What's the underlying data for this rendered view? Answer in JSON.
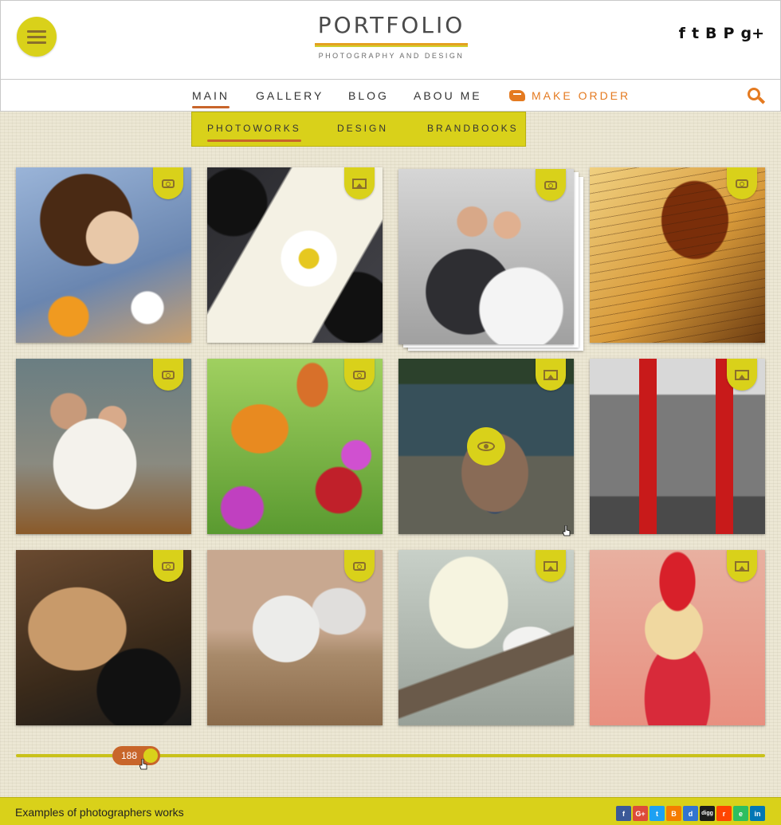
{
  "header": {
    "logo_title": "PORTFOLIO",
    "logo_subtitle": "PHOTOGRAPHY AND DESIGN",
    "social": [
      {
        "name": "facebook",
        "glyph": "f"
      },
      {
        "name": "twitter",
        "glyph": "t"
      },
      {
        "name": "blogger",
        "glyph": "B"
      },
      {
        "name": "pinterest",
        "glyph": "P"
      },
      {
        "name": "google-plus",
        "glyph": "g+"
      }
    ]
  },
  "nav": {
    "items": [
      "MAIN",
      "GALLERY",
      "BLOG",
      "ABOU ME"
    ],
    "order_label": "MAKE ORDER",
    "active": "MAIN"
  },
  "subnav": {
    "items": [
      "PHOTOWORKS",
      "DESIGN",
      "BRANDBOOKS"
    ],
    "active": "PHOTOWORKS"
  },
  "gallery": {
    "tiles": [
      {
        "subject": "woman-with-flowers",
        "badge": "camera-icon",
        "colors": [
          "#8aa3c8",
          "#e89a2a",
          "#5a3a20"
        ]
      },
      {
        "subject": "cameras-and-daisy-photo",
        "badge": "picture-icon",
        "colors": [
          "#2a2a2e",
          "#f4f1e4",
          "#e6c820"
        ]
      },
      {
        "subject": "wedding-couple-kiss",
        "badge": "camera-icon",
        "colors": [
          "#b8b8b8",
          "#3a3a3a",
          "#f2f2f2"
        ]
      },
      {
        "subject": "violin-on-sheet-music",
        "badge": "camera-icon",
        "colors": [
          "#6a3a10",
          "#d89a3a",
          "#f0d080"
        ]
      },
      {
        "subject": "couple-on-beach",
        "badge": "camera-icon",
        "colors": [
          "#7a8a8a",
          "#f2f0ea",
          "#8a5a2a"
        ]
      },
      {
        "subject": "butterflies-on-flowers",
        "badge": "camera-icon",
        "colors": [
          "#7ab840",
          "#e08a20",
          "#c040c0"
        ]
      },
      {
        "subject": "woman-on-beach",
        "badge": "picture-icon",
        "colors": [
          "#5a7a8a",
          "#c89a7a",
          "#2a4a6a"
        ]
      },
      {
        "subject": "red-telephone-booths",
        "badge": "picture-icon",
        "colors": [
          "#8a8a8a",
          "#c81a1a",
          "#3a3a3a"
        ]
      },
      {
        "subject": "cat-with-camera",
        "badge": "camera-icon",
        "colors": [
          "#c89a6a",
          "#3a2a1a",
          "#1a1a1a"
        ]
      },
      {
        "subject": "running-horses",
        "badge": "camera-icon",
        "colors": [
          "#c8a890",
          "#e8e4e0",
          "#8a6a4a"
        ]
      },
      {
        "subject": "cockatoos-on-branch",
        "badge": "picture-icon",
        "colors": [
          "#b8c0b8",
          "#f2f2f0",
          "#6a5a4a"
        ]
      },
      {
        "subject": "woman-with-flower-crown",
        "badge": "picture-icon",
        "colors": [
          "#e8a090",
          "#d8202a",
          "#f0d8a0"
        ]
      }
    ],
    "hovered_tile": "woman-on-beach"
  },
  "slider": {
    "value": "188"
  },
  "footer": {
    "text": "Examples of photographers works",
    "share": [
      {
        "name": "facebook",
        "glyph": "f",
        "color": "#3b5998"
      },
      {
        "name": "google-plus",
        "glyph": "G+",
        "color": "#dd4b39"
      },
      {
        "name": "twitter",
        "glyph": "t",
        "color": "#1da1f2"
      },
      {
        "name": "blogger",
        "glyph": "B",
        "color": "#f57d00"
      },
      {
        "name": "delicious",
        "glyph": "d",
        "color": "#3274d1"
      },
      {
        "name": "digg",
        "glyph": "digg",
        "color": "#1d1d1b"
      },
      {
        "name": "reddit",
        "glyph": "r",
        "color": "#ff4500"
      },
      {
        "name": "evernote",
        "glyph": "e",
        "color": "#2dbe60"
      },
      {
        "name": "linkedin",
        "glyph": "in",
        "color": "#0077b5"
      }
    ]
  },
  "colors": {
    "accent": "#d9d11a",
    "orange": "#e47a20",
    "underline": "#c8652a",
    "background": "#ece7d4"
  }
}
